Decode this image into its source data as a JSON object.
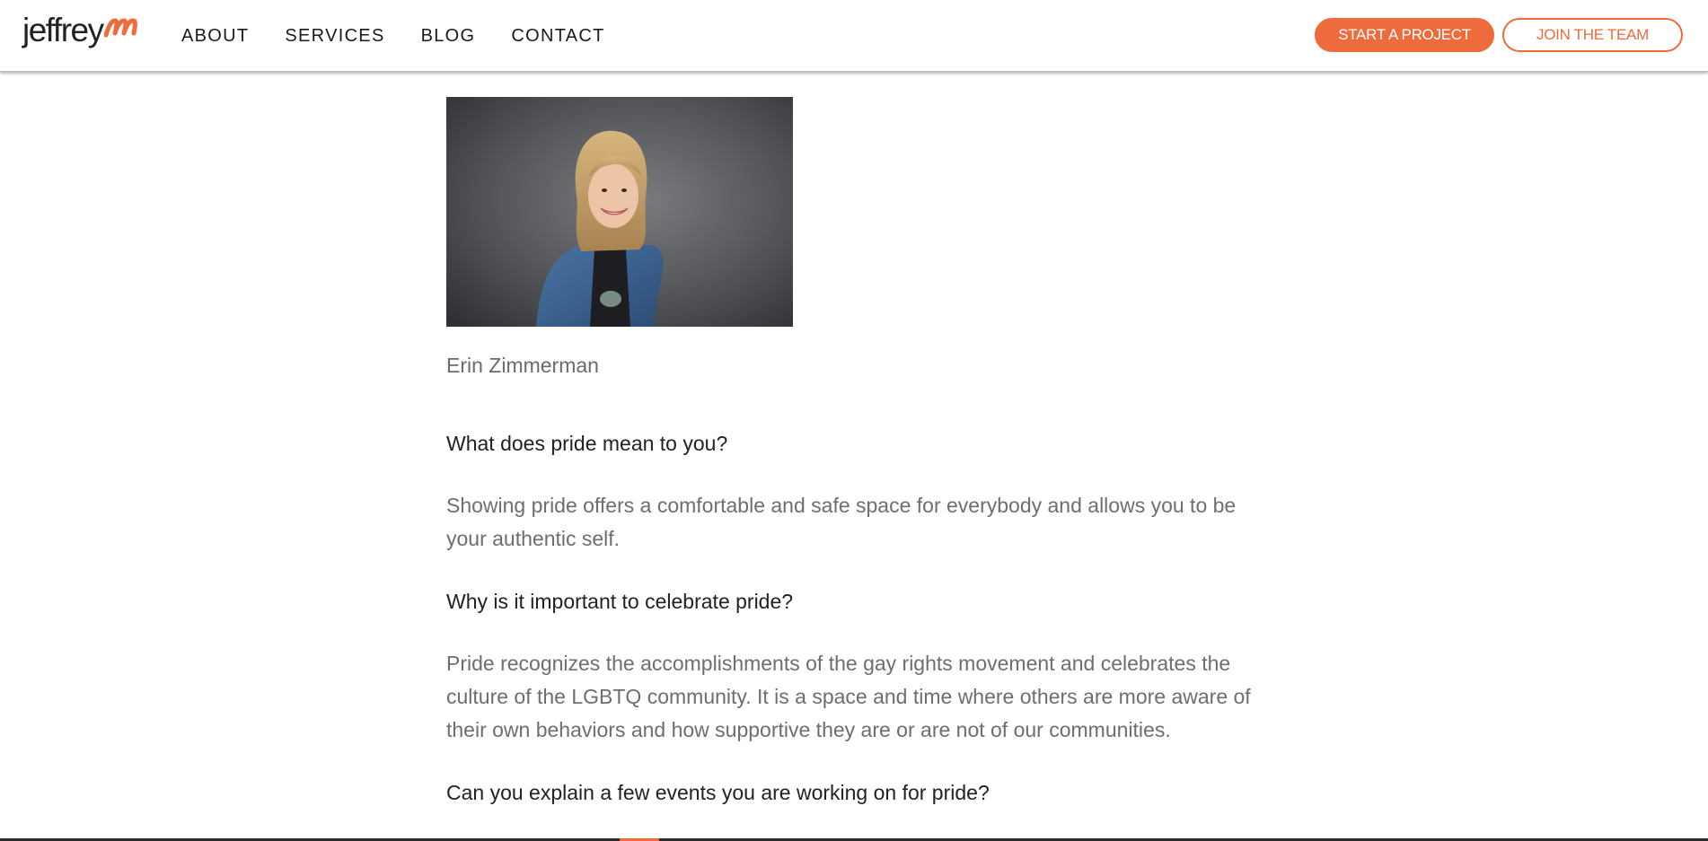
{
  "header": {
    "logo_text": "jeffrey",
    "logo_mark_icon": "m-script-logo-icon",
    "nav": [
      {
        "label": "ABOUT"
      },
      {
        "label": "SERVICES"
      },
      {
        "label": "BLOG"
      },
      {
        "label": "CONTACT"
      }
    ],
    "start_project_label": "START A PROJECT",
    "join_team_label": "JOIN THE TEAM"
  },
  "article": {
    "photo_caption": "Erin Zimmerman",
    "qa": [
      {
        "question": "What does pride mean to you?",
        "answer": "Showing pride offers a comfortable and safe space for everybody and allows you to be your authentic self."
      },
      {
        "question": "Why is it important to celebrate pride?",
        "answer": "Pride recognizes the accomplishments of the gay rights movement and celebrates the culture of the LGBTQ community. It is a space and time where others are more aware of their own behaviors and how supportive they are or are not of our communities."
      },
      {
        "question": "Can you explain a few events you are working on for pride?"
      }
    ]
  },
  "colors": {
    "brand_orange": "#ee6b3c",
    "heading_text": "#222222",
    "body_text": "#6e6e6e"
  }
}
